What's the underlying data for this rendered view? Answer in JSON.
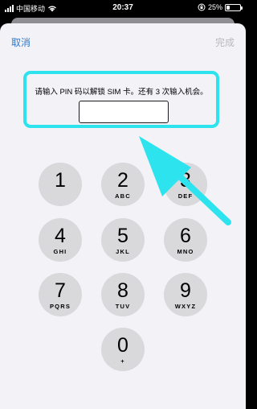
{
  "status": {
    "carrier": "中国移动",
    "time": "20:37",
    "battery_percent": "25%",
    "battery_level": 0.25,
    "icons": [
      "signal-icon",
      "wifi-icon",
      "orientation-lock-icon",
      "battery-icon"
    ]
  },
  "nav": {
    "cancel": "取消",
    "done": "完成"
  },
  "prompt": {
    "text": "请输入 PIN 码以解锁 SIM 卡。还有 3 次输入机会。",
    "pin_value": ""
  },
  "keypad": {
    "keys": [
      {
        "digit": "1",
        "letters": ""
      },
      {
        "digit": "2",
        "letters": "ABC"
      },
      {
        "digit": "3",
        "letters": "DEF"
      },
      {
        "digit": "4",
        "letters": "GHI"
      },
      {
        "digit": "5",
        "letters": "JKL"
      },
      {
        "digit": "6",
        "letters": "MNO"
      },
      {
        "digit": "7",
        "letters": "PQRS"
      },
      {
        "digit": "8",
        "letters": "TUV"
      },
      {
        "digit": "9",
        "letters": "WXYZ"
      },
      {
        "digit": "0",
        "letters": "+"
      }
    ]
  },
  "colors": {
    "accent": "#3478c6",
    "highlight": "#2de4ee",
    "key_bg": "#d9d9dc",
    "disabled": "#b9b9bd"
  }
}
